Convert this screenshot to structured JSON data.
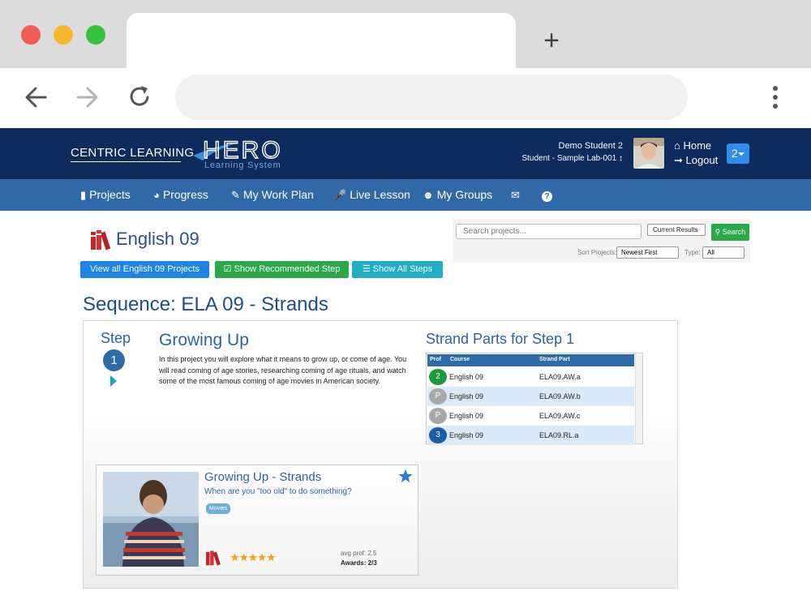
{
  "browser": {
    "new_tab_symbol": "+",
    "icons": [
      "back-arrow-icon",
      "forward-arrow-icon",
      "reload-icon",
      "more-vertical-icon"
    ]
  },
  "header": {
    "brand_text": "CENTRIC LEARNING",
    "logo_title": "HERO",
    "logo_subtitle": "Learning System",
    "user_name": "Demo Student 2",
    "user_role": "Student - Sample Lab-001 ↕",
    "home_label": "Home",
    "logout_label": "Logout",
    "notification_count": "2"
  },
  "nav": {
    "items": [
      {
        "label": "Projects",
        "icon": "book-icon"
      },
      {
        "label": "Progress",
        "icon": "dashboard-icon"
      },
      {
        "label": "My Work Plan",
        "icon": "pencil-icon"
      },
      {
        "label": "Live Lesson",
        "icon": "microphone-icon"
      },
      {
        "label": "My Groups",
        "icon": "users-icon"
      },
      {
        "label": "",
        "icon": "envelope-icon"
      },
      {
        "label": "",
        "icon": "help-icon"
      }
    ]
  },
  "course": {
    "title": "English 09",
    "view_all_label": "View all English 09 Projects",
    "show_recommended_label": "Show Recommended Step",
    "show_all_steps_label": "Show All Steps"
  },
  "search": {
    "placeholder": "Search projects...",
    "scope": "Current Results",
    "button_label": "Search",
    "sort_label": "Sort Projects:",
    "sort_value": "Newest First",
    "type_label": "Type:",
    "type_value": "All"
  },
  "sequence": {
    "title": "Sequence: ELA 09 - Strands",
    "step_label": "Step",
    "step_number": "1",
    "project_title": "Growing Up",
    "project_description": "In this project you will explore what it means to grow up, or come of age. You will read coming of age stories, researching coming of age rituals, and watch some of the most famous coming of age movies in American society."
  },
  "strand_parts": {
    "title": "Strand Parts for Step 1",
    "columns": [
      "Prof",
      "Course",
      "Strand Part"
    ],
    "rows": [
      {
        "prof": "2",
        "prof_color": "#1e9a3a",
        "course": "English 09",
        "part": "ELA09.AW.a"
      },
      {
        "prof": "P",
        "prof_color": "#a8a8a8",
        "course": "English 09",
        "part": "ELA09.AW.b"
      },
      {
        "prof": "P",
        "prof_color": "#a8a8a8",
        "course": "English 09",
        "part": "ELA09.AW.c"
      },
      {
        "prof": "3",
        "prof_color": "#1a5ca8",
        "course": "English 09",
        "part": "ELA09.RL.a"
      }
    ]
  },
  "project_card": {
    "title": "Growing Up - Strands",
    "question": "When are you \"too old\" to do something?",
    "tag": "Movies",
    "rating_stars": 5,
    "avg_prof": "avg prof: 2.5",
    "awards": "Awards: 2/3"
  },
  "colors": {
    "header_bg": "#0d2b5c",
    "nav_bg": "#2f69a8",
    "accent_blue": "#1e84e6",
    "accent_green": "#2aa84a",
    "accent_teal": "#20aec5"
  }
}
